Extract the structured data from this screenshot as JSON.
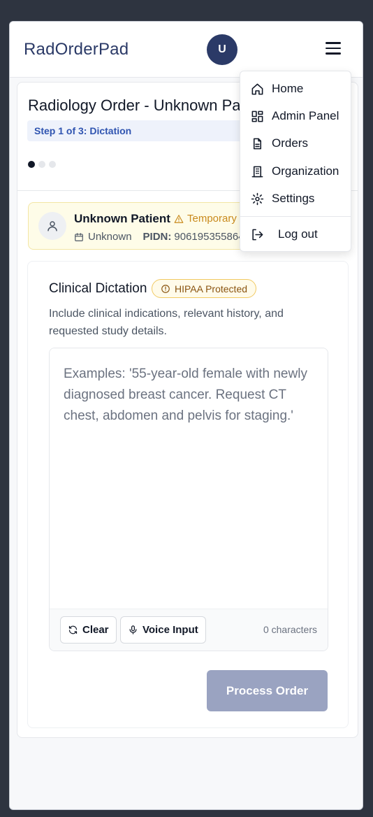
{
  "header": {
    "brand": "RadOrderPad",
    "avatar_initial": "U"
  },
  "order": {
    "title": "Radiology Order - Unknown Patient",
    "step_label": "Step 1 of 3: Dictation",
    "steps_total": 3,
    "current_step": 1
  },
  "patient": {
    "name": "Unknown Patient",
    "badge": "Temporary",
    "dob": "Unknown",
    "pidn_label": "PIDN:",
    "pidn_value": "906195355864"
  },
  "dictation": {
    "title": "Clinical Dictation",
    "hipaa_label": "HIPAA Protected",
    "subtitle": "Include clinical indications, relevant history, and requested study details.",
    "placeholder": "Examples: '55-year-old female with newly diagnosed breast cancer. Request CT chest, abdomen and pelvis for staging.'",
    "clear_label": "Clear",
    "voice_label": "Voice Input",
    "char_count": "0 characters",
    "process_label": "Process Order"
  },
  "menu": {
    "items": [
      {
        "label": "Home",
        "icon": "home-icon"
      },
      {
        "label": "Admin Panel",
        "icon": "dashboard-icon"
      },
      {
        "label": "Orders",
        "icon": "file-icon"
      },
      {
        "label": "Organization",
        "icon": "building-icon"
      },
      {
        "label": "Settings",
        "icon": "gear-icon"
      }
    ],
    "logout_label": "Log out"
  },
  "colors": {
    "brand": "#2b3a67",
    "accent": "#2f54b0",
    "warning": "#c98a1d",
    "disabled_button": "#9aa3c1"
  }
}
